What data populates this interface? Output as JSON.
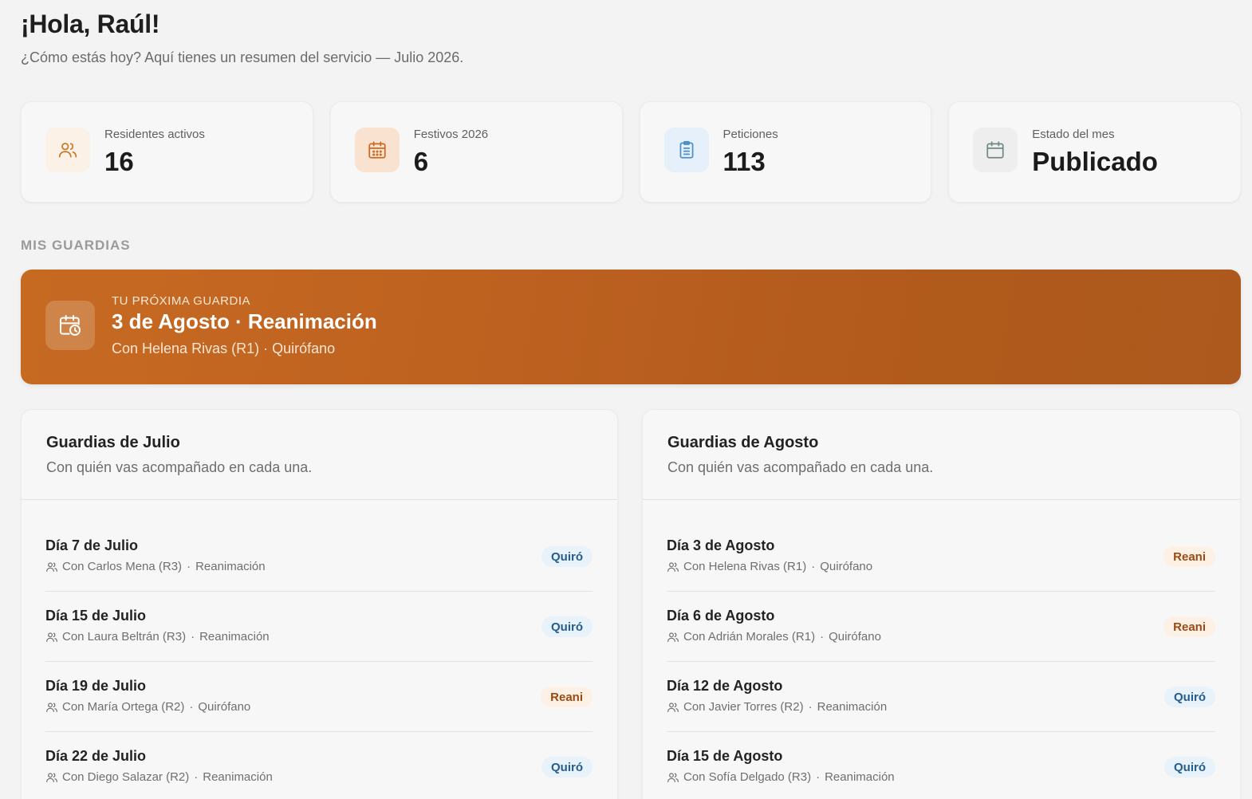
{
  "header": {
    "greeting": "¡Hola, Raúl!",
    "subtitle": "¿Cómo estás hoy? Aquí tienes un resumen del servicio — Julio 2026."
  },
  "stats": [
    {
      "label": "Residentes activos",
      "value": "16",
      "icon": "users-icon",
      "color": "#c97a2c"
    },
    {
      "label": "Festivos 2026",
      "value": "6",
      "icon": "calendar-grid-icon",
      "color": "#c96a24"
    },
    {
      "label": "Peticiones",
      "value": "113",
      "icon": "clipboard-list-icon",
      "color": "#4a90c9"
    },
    {
      "label": "Estado del mes",
      "value": "Publicado",
      "icon": "calendar-icon",
      "color": "#6f8a85"
    }
  ],
  "section_label": "MIS GUARDIAS",
  "next_guard": {
    "kicker": "TU PRÓXIMA GUARDIA",
    "title": "3 de Agosto · Reanimación",
    "subtitle": "Con Helena Rivas (R1) · Quirófano",
    "icon": "calendar-clock-icon",
    "color": "#bd6120"
  },
  "panels": [
    {
      "title": "Guardias de Julio",
      "subtitle": "Con quién vas acompañado en cada una.",
      "rows": [
        {
          "day": "Día 7 de Julio",
          "with": "Con Carlos Mena (R3)",
          "area": "Reanimación",
          "badge": "Quiró"
        },
        {
          "day": "Día 15 de Julio",
          "with": "Con Laura Beltrán (R3)",
          "area": "Reanimación",
          "badge": "Quiró"
        },
        {
          "day": "Día 19 de Julio",
          "with": "Con María Ortega (R2)",
          "area": "Quirófano",
          "badge": "Reani"
        },
        {
          "day": "Día 22 de Julio",
          "with": "Con Diego Salazar (R2)",
          "area": "Reanimación",
          "badge": "Quiró"
        }
      ]
    },
    {
      "title": "Guardias de Agosto",
      "subtitle": "Con quién vas acompañado en cada una.",
      "rows": [
        {
          "day": "Día 3 de Agosto",
          "with": "Con Helena Rivas (R1)",
          "area": "Quirófano",
          "badge": "Reani"
        },
        {
          "day": "Día 6 de Agosto",
          "with": "Con Adrián Morales (R1)",
          "area": "Quirófano",
          "badge": "Reani"
        },
        {
          "day": "Día 12 de Agosto",
          "with": "Con Javier Torres (R2)",
          "area": "Reanimación",
          "badge": "Quiró"
        },
        {
          "day": "Día 15 de Agosto",
          "with": "Con Sofía Delgado (R3)",
          "area": "Reanimación",
          "badge": "Quiró"
        }
      ]
    }
  ],
  "colors": {
    "badge_quiro_bg": "#e8f2fb",
    "badge_quiro_text": "#245d8e",
    "badge_reani_bg": "#fcf1e4",
    "badge_reani_text": "#9a4a12"
  }
}
